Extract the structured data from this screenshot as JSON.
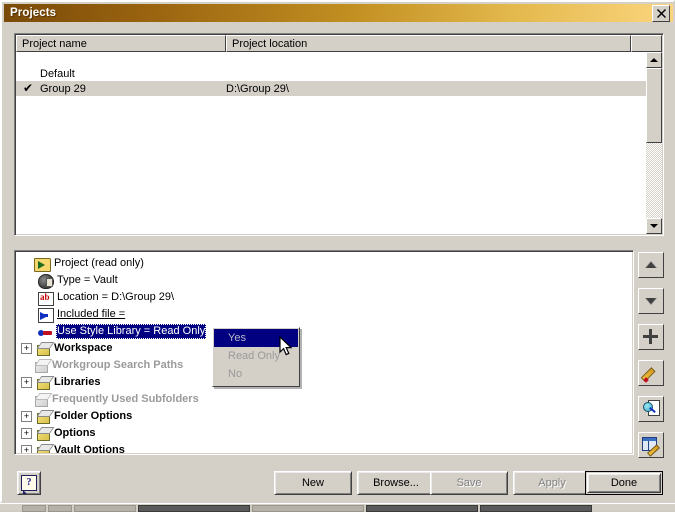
{
  "window": {
    "title": "Projects",
    "close_label": "✕",
    "close_icon": "close-icon"
  },
  "list": {
    "columns": [
      "Project name",
      "Project location"
    ],
    "rows": [
      {
        "checked": "",
        "name": "Default",
        "location": "",
        "selected": false
      },
      {
        "checked": "✔",
        "name": "Group 29",
        "location": "D:\\Group 29\\",
        "selected": true
      }
    ]
  },
  "tree": {
    "nodes": [
      {
        "expander": "",
        "icon": "folder-arrow-icon",
        "label": "Project (read only)",
        "style": ""
      },
      {
        "expander": "",
        "icon": "vault-icon",
        "label": "Type = Vault",
        "style": ""
      },
      {
        "expander": "",
        "icon": "ab-text-icon",
        "label": "Location = D:\\Group 29\\",
        "style": ""
      },
      {
        "expander": "",
        "icon": "included-file-icon",
        "label": "Included file = ",
        "style": "under"
      },
      {
        "expander": "",
        "icon": "style-library-icon",
        "label": "Use Style Library = Read Only",
        "style": "selected"
      },
      {
        "expander": "+",
        "icon": "box-icon",
        "label": "Workspace",
        "style": "bold"
      },
      {
        "expander": "",
        "icon": "box-icon-gray",
        "label": "Workgroup Search Paths",
        "style": "gray"
      },
      {
        "expander": "+",
        "icon": "box-icon",
        "label": "Libraries",
        "style": "bold"
      },
      {
        "expander": "",
        "icon": "box-icon-gray",
        "label": "Frequently Used Subfolders",
        "style": "gray"
      },
      {
        "expander": "+",
        "icon": "box-icon",
        "label": "Folder Options",
        "style": "bold"
      },
      {
        "expander": "+",
        "icon": "box-icon",
        "label": "Options",
        "style": "bold"
      },
      {
        "expander": "+",
        "icon": "box-icon",
        "label": "Vault Options",
        "style": "bold"
      }
    ]
  },
  "dropdown": {
    "items": [
      {
        "label": "Yes",
        "highlighted": true
      },
      {
        "label": "Read Only",
        "highlighted": false
      },
      {
        "label": "No",
        "highlighted": false
      }
    ]
  },
  "toolbar": {
    "buttons": [
      {
        "name": "move-up-button",
        "icon": "arrow-up-icon"
      },
      {
        "name": "move-down-button",
        "icon": "arrow-down-icon"
      },
      {
        "name": "add-button",
        "icon": "plus-icon"
      },
      {
        "name": "edit-button",
        "icon": "pencil-icon"
      },
      {
        "name": "browse-button",
        "icon": "magnifier-page-icon"
      },
      {
        "name": "expand-editor-button",
        "icon": "grid-pencil-icon"
      }
    ]
  },
  "footer": {
    "help_label": "?",
    "buttons": [
      {
        "label": "New",
        "disabled": false,
        "default": false
      },
      {
        "label": "Browse...",
        "disabled": false,
        "default": false
      },
      {
        "label": "Save",
        "disabled": true,
        "default": false
      },
      {
        "label": "Apply",
        "disabled": true,
        "default": false
      },
      {
        "label": "Done",
        "disabled": false,
        "default": true
      }
    ]
  },
  "colors": {
    "title_start": "#7a4a08",
    "title_end": "#fbd57e",
    "face": "#d4d0c8",
    "selection": "#000080"
  }
}
